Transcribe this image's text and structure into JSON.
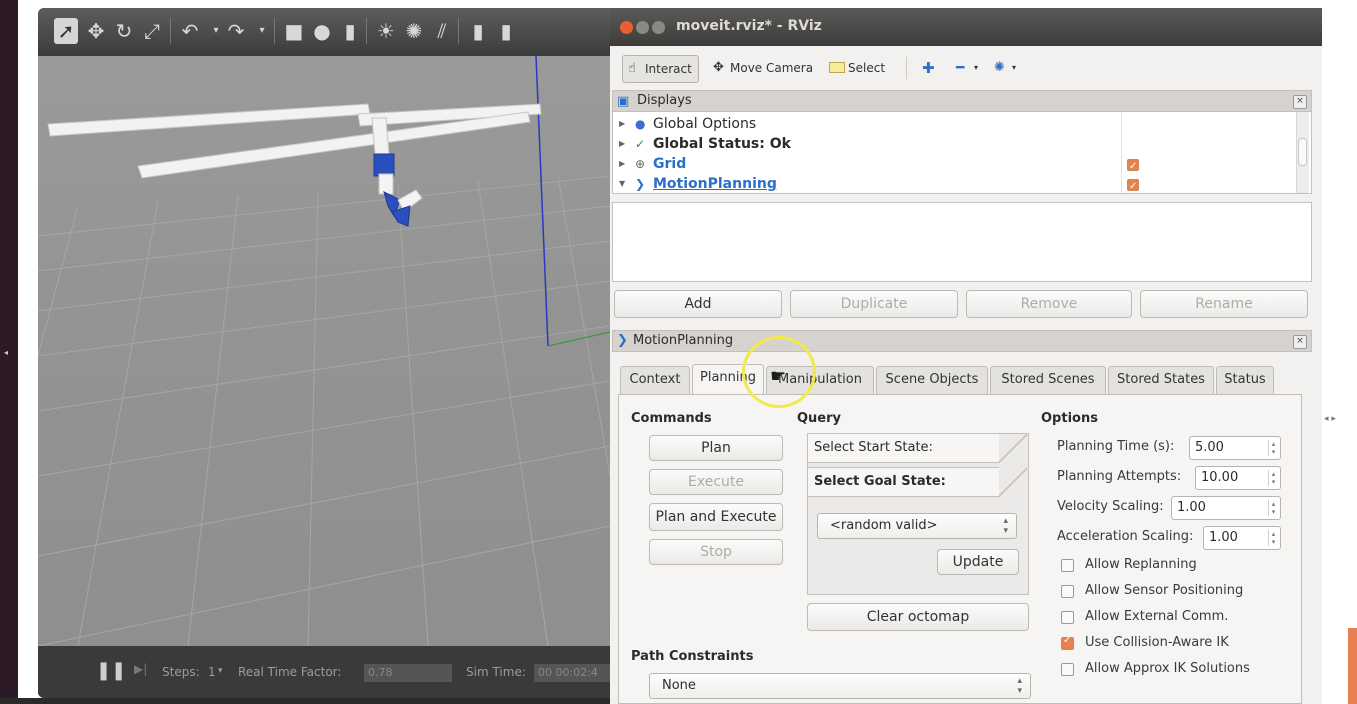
{
  "gazebo": {
    "steps_label": "Steps:",
    "steps_value": "1",
    "rtf_label": "Real Time Factor:",
    "rtf_value": "0.78",
    "sim_time_label": "Sim Time:",
    "sim_time_value": "00 00:02:4"
  },
  "window": {
    "title": "moveit.rviz* - RViz"
  },
  "toolbar": {
    "interact": "Interact",
    "move_camera": "Move Camera",
    "select": "Select"
  },
  "displays": {
    "header": "Displays",
    "items": [
      {
        "label": "Global Options",
        "icon": "globe-icon"
      },
      {
        "label": "Global Status: Ok",
        "icon": "checkmark-icon"
      },
      {
        "label": "Grid",
        "icon": "grid-icon",
        "checked": true
      },
      {
        "label": "MotionPlanning",
        "icon": "moveit-icon",
        "checked": true
      }
    ],
    "buttons": {
      "add": "Add",
      "duplicate": "Duplicate",
      "remove": "Remove",
      "rename": "Rename"
    }
  },
  "motion_planning": {
    "header": "MotionPlanning",
    "tabs": [
      "Context",
      "Planning",
      "Manipulation",
      "Scene Objects",
      "Stored Scenes",
      "Stored States",
      "Status"
    ],
    "active_tab": "Planning",
    "commands": {
      "title": "Commands",
      "plan": "Plan",
      "execute": "Execute",
      "plan_and_execute": "Plan and Execute",
      "stop": "Stop"
    },
    "query": {
      "title": "Query",
      "start_state": "Select Start State:",
      "goal_state": "Select Goal State:",
      "goal_value": "<random valid>",
      "update": "Update",
      "clear_octomap": "Clear octomap"
    },
    "path_constraints": {
      "title": "Path Constraints",
      "value": "None"
    },
    "options": {
      "title": "Options",
      "planning_time_label": "Planning Time (s):",
      "planning_time": "5.00",
      "planning_attempts_label": "Planning Attempts:",
      "planning_attempts": "10.00",
      "velocity_scaling_label": "Velocity Scaling:",
      "velocity_scaling": "1.00",
      "acceleration_scaling_label": "Acceleration Scaling:",
      "acceleration_scaling": "1.00",
      "checkboxes": [
        {
          "label": "Allow Replanning",
          "checked": false
        },
        {
          "label": "Allow Sensor Positioning",
          "checked": false
        },
        {
          "label": "Allow External Comm.",
          "checked": false
        },
        {
          "label": "Use Collision-Aware IK",
          "checked": true
        },
        {
          "label": "Allow Approx IK Solutions",
          "checked": false
        }
      ]
    }
  },
  "colors": {
    "accent_orange": "#e8804f",
    "highlight_yellow": "#f2e84a",
    "link_blue": "#2a6fc9"
  }
}
